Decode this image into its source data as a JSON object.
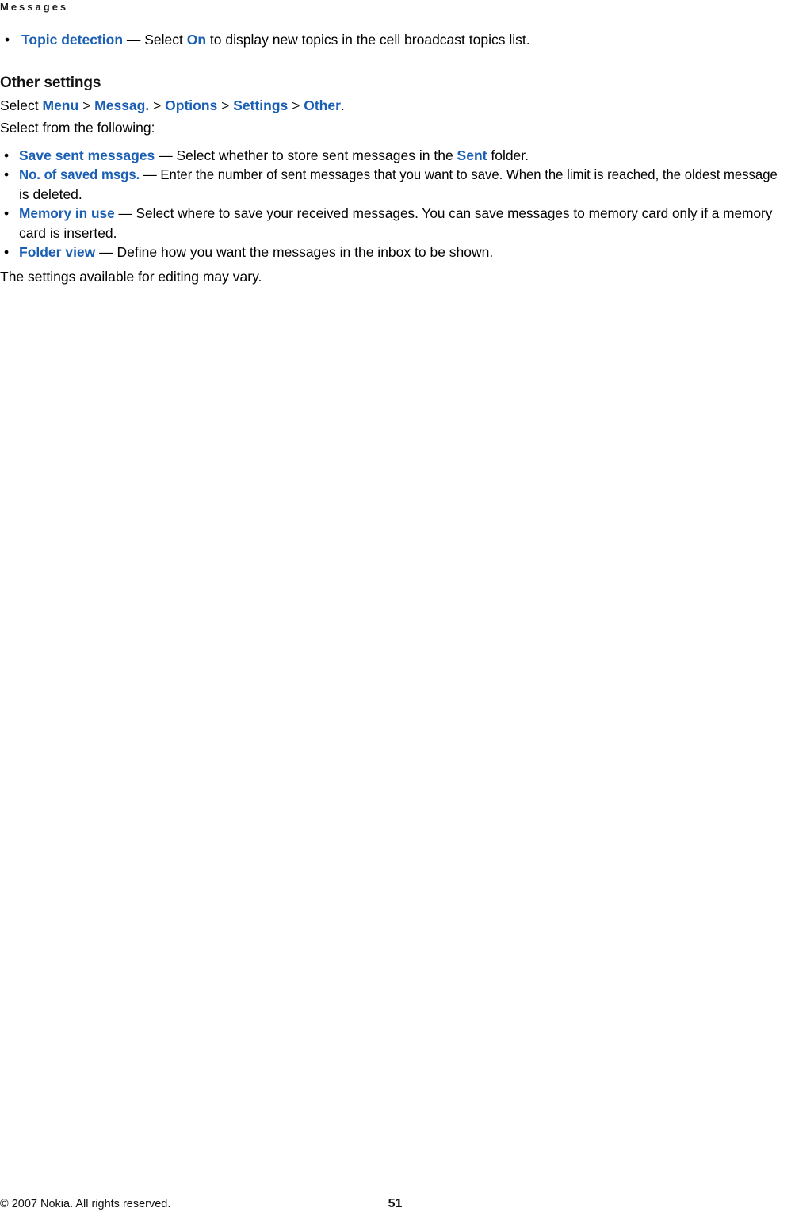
{
  "header": {
    "running_title": "Messages"
  },
  "content": {
    "lead_bullet": {
      "term": "Topic detection",
      "dash": " — Select ",
      "value": "On",
      "tail": " to display new topics in the cell broadcast topics list."
    },
    "section": {
      "heading": "Other settings",
      "path_prefix": "Select ",
      "path_items": [
        "Menu",
        "Messag.",
        "Options",
        "Settings",
        "Other"
      ],
      "path_separator": " > ",
      "path_suffix": ".",
      "intro": "Select from the following:"
    },
    "settings_bullets": [
      {
        "term": "Save sent messages",
        "body_before": " — Select whether to store sent messages in the ",
        "inline_term": "Sent",
        "body_after": " folder."
      },
      {
        "term": "No. of saved msgs.",
        "body_before": " — Enter the number of sent messages that you want to save. When the limit is reached, the oldest message",
        "inline_term": "",
        "body_after": "is deleted."
      },
      {
        "term": "Memory in use",
        "body_before": " — Select where to save your received messages. You can save messages to memory card only if a memory",
        "inline_term": "",
        "body_after": "card is inserted."
      },
      {
        "term": "Folder view",
        "body_before": " — Define how you want the messages in the inbox to be shown.",
        "inline_term": "",
        "body_after": ""
      }
    ],
    "closing_note": "The settings available for editing may vary."
  },
  "footer": {
    "copyright": "© 2007 Nokia. All rights reserved.",
    "page_number": "51"
  },
  "colors": {
    "link_blue": "#1a5fb4",
    "text_black": "#000000",
    "page_background": "#ffffff"
  },
  "bullet_glyph": "•"
}
